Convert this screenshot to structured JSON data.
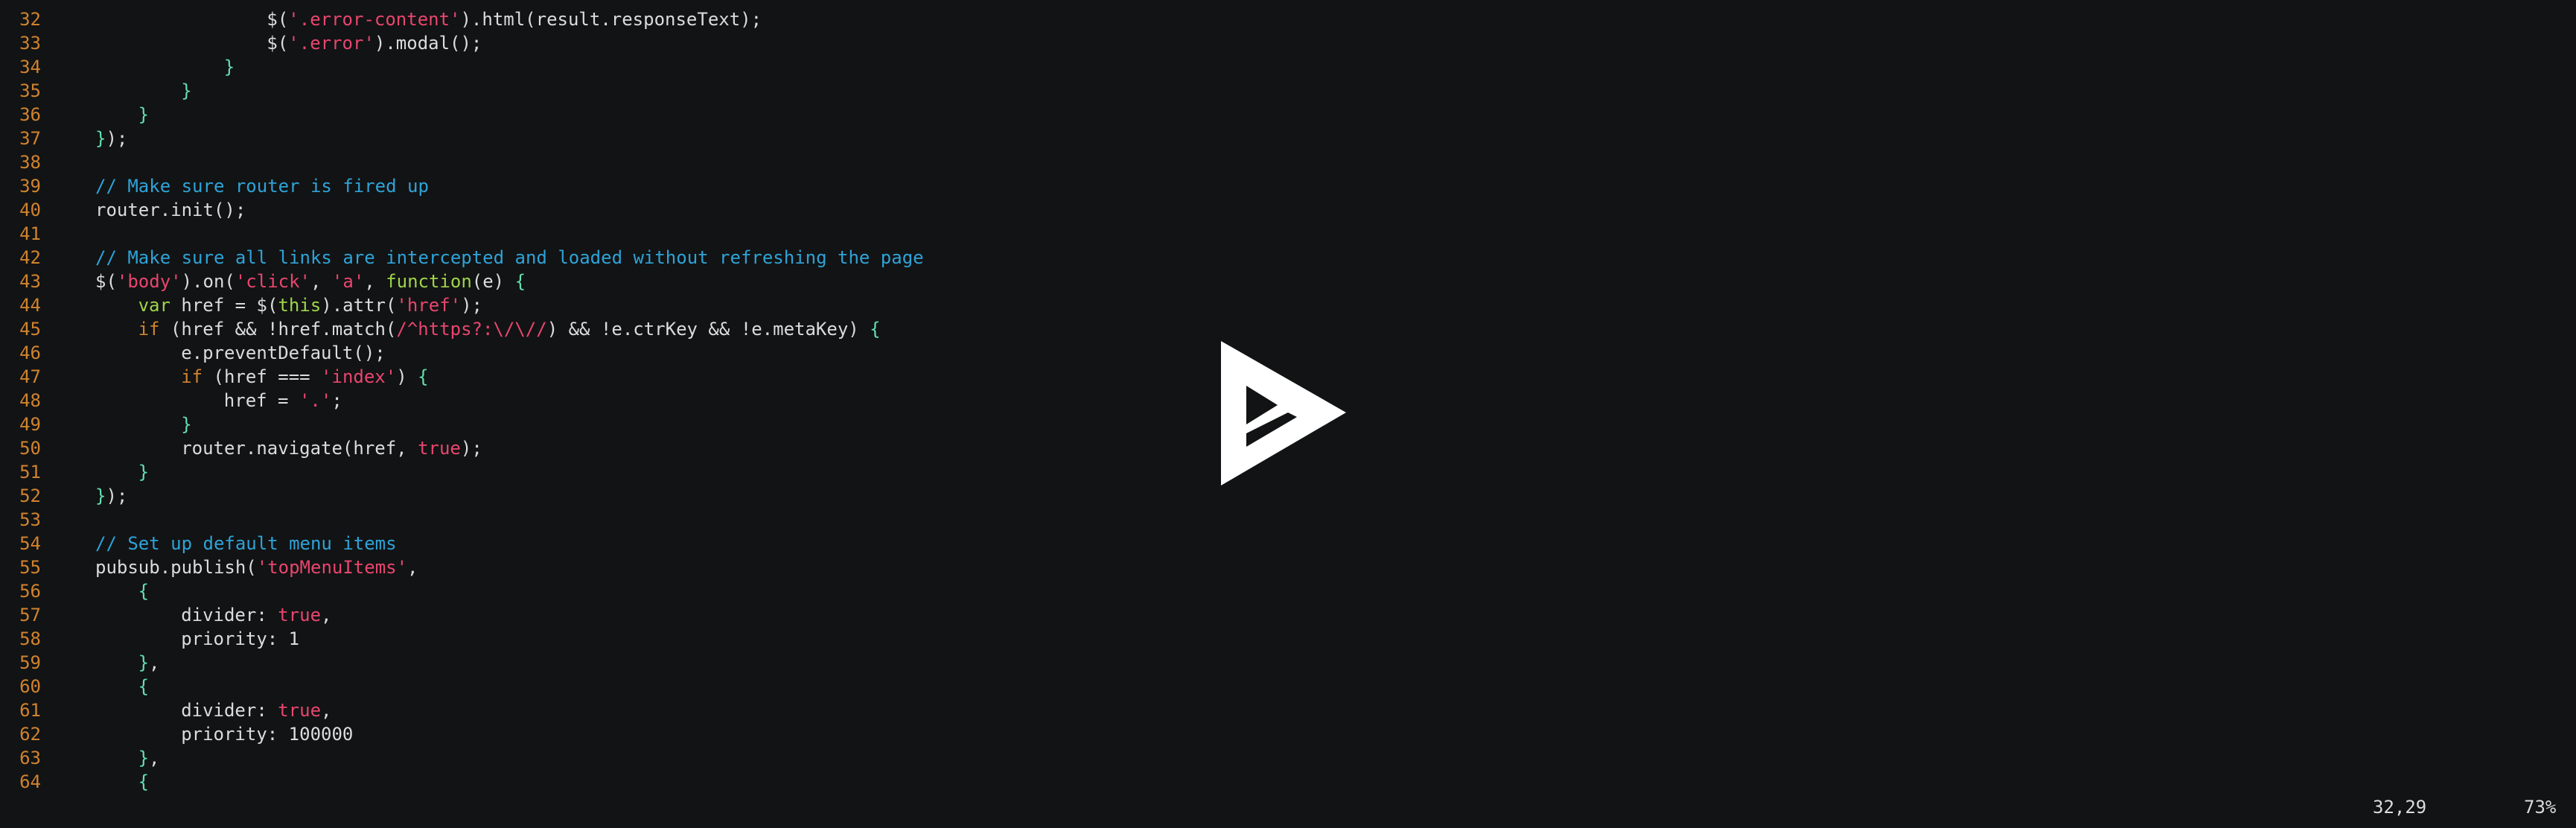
{
  "editor": {
    "lines": [
      {
        "n": "32",
        "indent": 8,
        "tokens": [
          [
            "t",
            "$("
          ],
          [
            "s",
            "'.error-content'"
          ],
          [
            "t",
            ").html(result.responseText);"
          ]
        ]
      },
      {
        "n": "33",
        "indent": 8,
        "tokens": [
          [
            "t",
            "$("
          ],
          [
            "s",
            "'.error'"
          ],
          [
            "t",
            ").modal();"
          ]
        ]
      },
      {
        "n": "34",
        "indent": 7,
        "tokens": [
          [
            "b",
            "}"
          ]
        ]
      },
      {
        "n": "35",
        "indent": 6,
        "tokens": [
          [
            "b",
            "}"
          ]
        ]
      },
      {
        "n": "36",
        "indent": 5,
        "tokens": [
          [
            "b",
            "}"
          ]
        ]
      },
      {
        "n": "37",
        "indent": 4,
        "tokens": [
          [
            "b",
            "}"
          ],
          [
            "t",
            ");"
          ]
        ]
      },
      {
        "n": "38",
        "indent": 0,
        "tokens": []
      },
      {
        "n": "39",
        "indent": 4,
        "tokens": [
          [
            "c",
            "// Make sure router is fired up"
          ]
        ]
      },
      {
        "n": "40",
        "indent": 4,
        "tokens": [
          [
            "t",
            "router.init();"
          ]
        ]
      },
      {
        "n": "41",
        "indent": 0,
        "tokens": []
      },
      {
        "n": "42",
        "indent": 4,
        "tokens": [
          [
            "c",
            "// Make sure all links are intercepted and loaded without refreshing the page"
          ]
        ]
      },
      {
        "n": "43",
        "indent": 4,
        "tokens": [
          [
            "t",
            "$("
          ],
          [
            "s",
            "'body'"
          ],
          [
            "t",
            ").on("
          ],
          [
            "s",
            "'click'"
          ],
          [
            "t",
            ", "
          ],
          [
            "s",
            "'a'"
          ],
          [
            "t",
            ", "
          ],
          [
            "k2",
            "function"
          ],
          [
            "t",
            "(e) "
          ],
          [
            "b",
            "{"
          ]
        ]
      },
      {
        "n": "44",
        "indent": 5,
        "tokens": [
          [
            "k2",
            "var"
          ],
          [
            "t",
            " href = $("
          ],
          [
            "k2",
            "this"
          ],
          [
            "t",
            ").attr("
          ],
          [
            "s",
            "'href'"
          ],
          [
            "t",
            ");"
          ]
        ]
      },
      {
        "n": "45",
        "indent": 5,
        "tokens": [
          [
            "k",
            "if"
          ],
          [
            "t",
            " (href && !href.match("
          ],
          [
            "s",
            "/^https?:\\/\\//"
          ],
          [
            "t",
            ") && !e.ctrKey && !e.metaKey) "
          ],
          [
            "b",
            "{"
          ]
        ]
      },
      {
        "n": "46",
        "indent": 6,
        "tokens": [
          [
            "t",
            "e.preventDefault();"
          ]
        ]
      },
      {
        "n": "47",
        "indent": 6,
        "tokens": [
          [
            "k",
            "if"
          ],
          [
            "t",
            " (href === "
          ],
          [
            "s",
            "'index'"
          ],
          [
            "t",
            ") "
          ],
          [
            "b",
            "{"
          ]
        ]
      },
      {
        "n": "48",
        "indent": 7,
        "tokens": [
          [
            "t",
            "href = "
          ],
          [
            "s",
            "'.'"
          ],
          [
            "t",
            ";"
          ]
        ]
      },
      {
        "n": "49",
        "indent": 6,
        "tokens": [
          [
            "b",
            "}"
          ]
        ]
      },
      {
        "n": "50",
        "indent": 6,
        "tokens": [
          [
            "t",
            "router.navigate(href, "
          ],
          [
            "v",
            "true"
          ],
          [
            "t",
            ");"
          ]
        ]
      },
      {
        "n": "51",
        "indent": 5,
        "tokens": [
          [
            "b",
            "}"
          ]
        ]
      },
      {
        "n": "52",
        "indent": 4,
        "tokens": [
          [
            "b",
            "}"
          ],
          [
            "t",
            ");"
          ]
        ]
      },
      {
        "n": "53",
        "indent": 0,
        "tokens": []
      },
      {
        "n": "54",
        "indent": 4,
        "tokens": [
          [
            "c",
            "// Set up default menu items"
          ]
        ]
      },
      {
        "n": "55",
        "indent": 4,
        "tokens": [
          [
            "t",
            "pubsub.publish("
          ],
          [
            "s",
            "'topMenuItems'"
          ],
          [
            "t",
            ","
          ]
        ]
      },
      {
        "n": "56",
        "indent": 5,
        "tokens": [
          [
            "b",
            "{"
          ]
        ]
      },
      {
        "n": "57",
        "indent": 6,
        "tokens": [
          [
            "t",
            "divider: "
          ],
          [
            "v",
            "true"
          ],
          [
            "t",
            ","
          ]
        ]
      },
      {
        "n": "58",
        "indent": 6,
        "tokens": [
          [
            "t",
            "priority: 1"
          ]
        ]
      },
      {
        "n": "59",
        "indent": 5,
        "tokens": [
          [
            "b",
            "}"
          ],
          [
            "t",
            ","
          ]
        ]
      },
      {
        "n": "60",
        "indent": 5,
        "tokens": [
          [
            "b",
            "{"
          ]
        ]
      },
      {
        "n": "61",
        "indent": 6,
        "tokens": [
          [
            "t",
            "divider: "
          ],
          [
            "v",
            "true"
          ],
          [
            "t",
            ","
          ]
        ]
      },
      {
        "n": "62",
        "indent": 6,
        "tokens": [
          [
            "t",
            "priority: 100000"
          ]
        ]
      },
      {
        "n": "63",
        "indent": 5,
        "tokens": [
          [
            "b",
            "}"
          ],
          [
            "t",
            ","
          ]
        ]
      },
      {
        "n": "64",
        "indent": 5,
        "tokens": [
          [
            "b",
            "{"
          ]
        ]
      }
    ]
  },
  "status": {
    "cursor_position": "32,29",
    "scroll_percent": "73%"
  },
  "overlay": {
    "icon": "play-logo-icon",
    "color": "#ffffff"
  },
  "colors": {
    "background": "#121314",
    "line_number": "#d0832e",
    "comment": "#2ea3d8",
    "string": "#e8466f",
    "keyword": "#d0832e",
    "keyword2": "#9fd44a",
    "bracket": "#62e0b0",
    "text": "#dcdcdc"
  }
}
